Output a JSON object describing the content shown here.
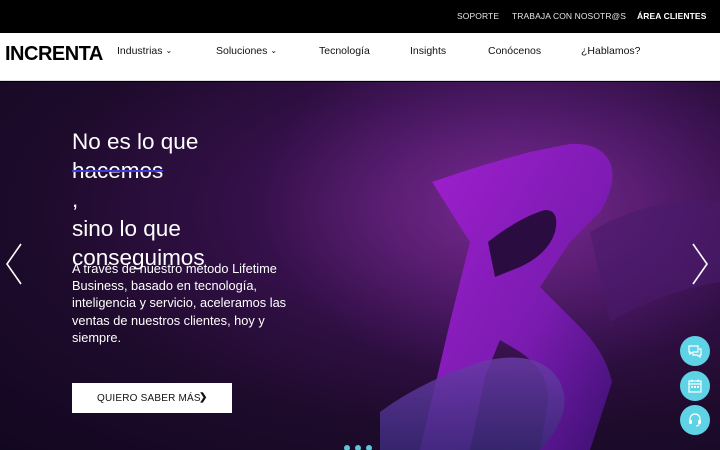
{
  "topbar": {
    "soporte": "SOPORTE",
    "trabaja": "TRABAJA CON NOSOTR@S",
    "area": "ÁREA CLIENTES"
  },
  "brand": {
    "logo_text": "INCRENTA"
  },
  "nav": {
    "industrias": "Industrias",
    "soluciones": "Soluciones",
    "tecnologia": "Tecnología",
    "insights": "Insights",
    "conocenos": "Conócenos",
    "hablamos": "¿Hablamos?",
    "chevron": "⌄"
  },
  "hero": {
    "line1": "No es lo que",
    "line2_struck": "hacemos",
    "line2_tail": ",",
    "line3": "sino lo que",
    "line4": "conseguimos",
    "sub_pre": "A través de nuestro método ",
    "sub_brand": "Lifetime Business",
    "sub_post": ", basado en tecnología, inteligencia y servicio, aceleramos las ventas de nuestros clientes, hoy y siempre.",
    "cta_label": "QUIERO SABER MÁS",
    "cta_arrow": "❯"
  },
  "colors": {
    "accent": "#5fd3e6",
    "strike": "#3b3bd6",
    "hero_bg": "#2a0d3d"
  },
  "icons": [
    "chevron-left-icon",
    "chevron-right-icon",
    "chat-icon",
    "calendar-icon",
    "headset-icon"
  ]
}
